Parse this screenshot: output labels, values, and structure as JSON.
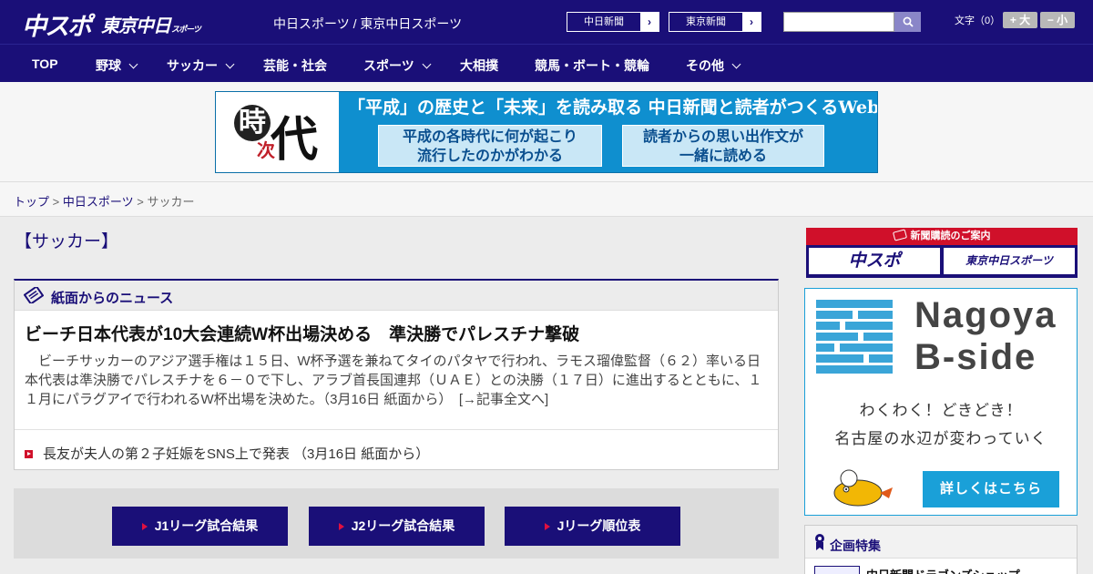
{
  "header": {
    "logo_chuspo": "中スポ",
    "logo_tokyo": "東京中日",
    "logo_tokyo_small": "スポーツ",
    "site_names": "中日スポーツ / 東京中日スポーツ",
    "btn_chunichi": "中日新聞",
    "btn_tokyo": "東京新聞",
    "font_size_label": "文字（0）",
    "font_larger": "+ 大",
    "font_smaller": "− 小"
  },
  "nav": {
    "items": [
      {
        "label": "TOP"
      },
      {
        "label": "野球"
      },
      {
        "label": "サッカー"
      },
      {
        "label": "芸能・社会"
      },
      {
        "label": "スポーツ"
      },
      {
        "label": "大相撲"
      },
      {
        "label": "競馬・ボート・競輪"
      },
      {
        "label": "その他"
      }
    ]
  },
  "banner": {
    "char1": "時",
    "char2": "代",
    "char3": "次",
    "headline": "「平成」の歴史と「未来」を読み取る 中日新聞と読者がつくるWebサイト",
    "box1_line1": "平成の各時代に何が起こり",
    "box1_line2": "流行したのかがわかる",
    "box2_line1": "読者からの思い出作文が",
    "box2_line2": "一緒に読める"
  },
  "breadcrumb": {
    "home": "トップ",
    "site": "中日スポーツ",
    "current": "サッカー",
    "sep": ">"
  },
  "main": {
    "page_title": "【サッカー】",
    "news_heading": "紙面からのニュース",
    "article_title": "ビーチ日本代表が10大会連続W杯出場決める　準決勝でパレスチナ撃破",
    "article_body": "　ビーチサッカーのアジア選手権は１５日、W杯予選を兼ねてタイのパタヤで行われ、ラモス瑠偉監督（６２）率いる日本代表は準決勝でパレスチナを６－０で下し、アラブ首長国連邦（ＵＡＥ）との決勝（１７日）に進出するとともに、１１月にパラグアイで行われるW杯出場を決めた。（3月16日 紙面から）　[→記事全文へ]",
    "sub_article": "長友が夫人の第２子妊娠をSNS上で発表 （3月16日 紙面から）",
    "buttons": [
      {
        "label": "J1リーグ試合結果"
      },
      {
        "label": "J2リーグ試合結果"
      },
      {
        "label": "Jリーグ順位表"
      }
    ]
  },
  "sidebar": {
    "subscribe_head": "新聞購読のご案内",
    "sub_chuspo": "中スポ",
    "sub_tokyo": "東京中日スポーツ",
    "bside_title_1": "Nagoya",
    "bside_title_2": "B-side",
    "bside_text_1": "わくわく！どきどき！",
    "bside_text_2": "名古屋の水辺が変わっていく",
    "bside_button": "詳しくはこちら",
    "kikaku_head": "企画特集",
    "kikaku_item": "中日新聞ドラゴンズショップ"
  },
  "colors": {
    "brand_navy": "#1a0f78",
    "accent_red": "#d0102a",
    "accent_blue": "#1aa0d8"
  }
}
